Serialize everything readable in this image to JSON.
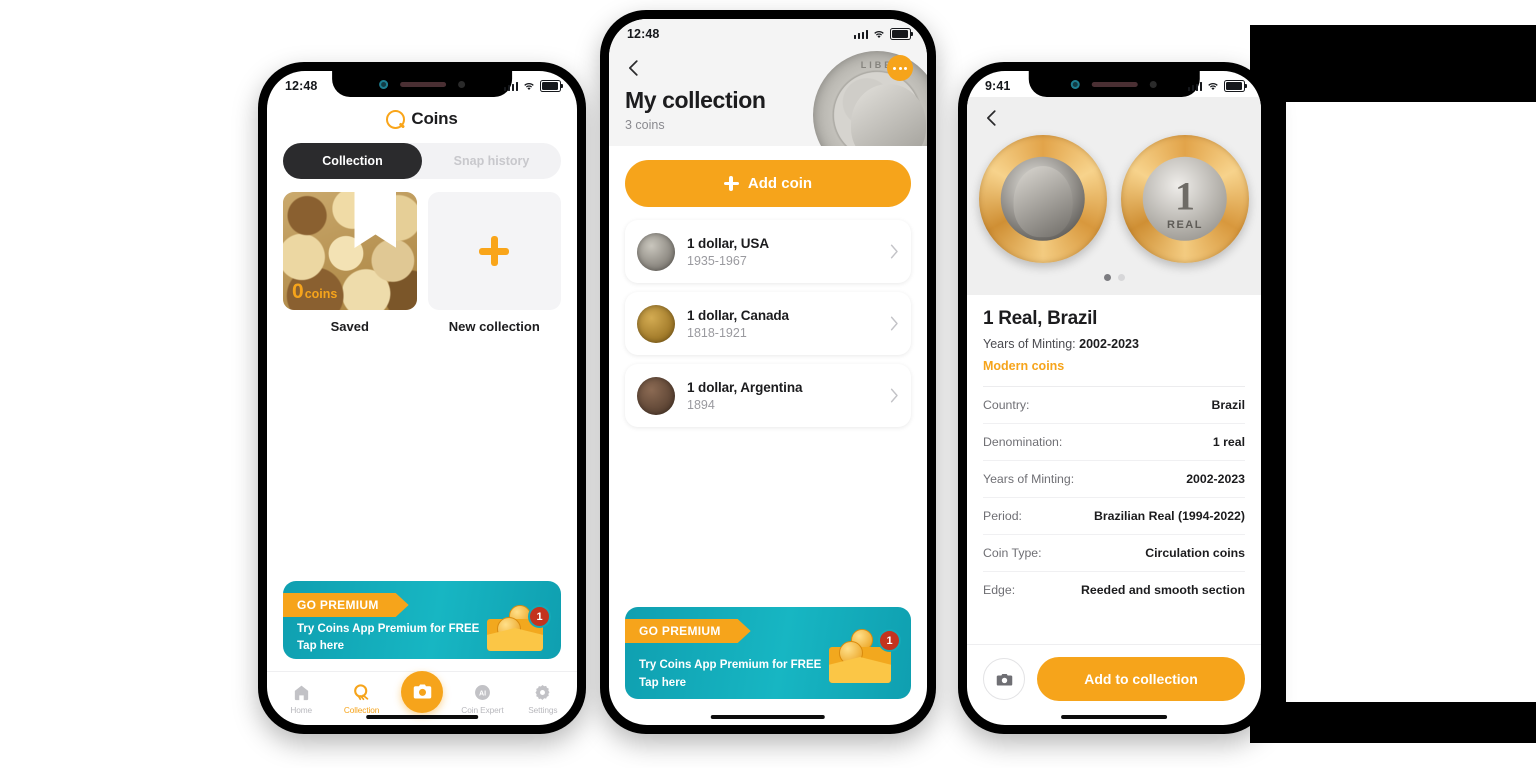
{
  "theme": {
    "accent": "#F6A41B",
    "dark": "#2b2b2d",
    "teal": "#17b6c3",
    "badge_red": "#C4331E"
  },
  "phone1": {
    "status": {
      "time": "12:48"
    },
    "app_title": "Coins",
    "tabs": [
      {
        "label": "Collection",
        "active": true
      },
      {
        "label": "Snap history",
        "active": false
      }
    ],
    "collections": [
      {
        "label": "Saved",
        "count": "0",
        "count_unit": "coins",
        "type": "thumbnail"
      },
      {
        "label": "New collection",
        "type": "add"
      }
    ],
    "promo": {
      "ribbon": "GO PREMIUM",
      "line1": "Try Coins App Premium for FREE",
      "line2": "Tap here",
      "badge": "1"
    },
    "nav": [
      {
        "label": "Home",
        "icon": "home-icon",
        "active": false
      },
      {
        "label": "Collection",
        "icon": "collection-icon",
        "active": true
      },
      {
        "label": "",
        "icon": "camera-icon",
        "active": false,
        "fab": true
      },
      {
        "label": "Coin Expert",
        "icon": "ai-icon",
        "active": false
      },
      {
        "label": "Settings",
        "icon": "gear-icon",
        "active": false
      }
    ]
  },
  "phone2": {
    "status": {
      "time": "12:48"
    },
    "title": "My collection",
    "subtitle": "3 coins",
    "add_button": "Add coin",
    "coins": [
      {
        "name": "1 dollar, USA",
        "years": "1935-1967"
      },
      {
        "name": "1 dollar, Canada",
        "years": "1818-1921"
      },
      {
        "name": "1 dollar, Argentina",
        "years": "1894"
      }
    ],
    "promo": {
      "ribbon": "GO PREMIUM",
      "line1": "Try Coins App Premium for FREE",
      "line2": "Tap here",
      "badge": "1"
    }
  },
  "phone3": {
    "status": {
      "time": "9:41"
    },
    "coin_name": "1 Real, Brazil",
    "years_label": "Years of Minting:",
    "years_value": "2002-2023",
    "category": "Modern coins",
    "gallery": {
      "pages": 2,
      "current": 1,
      "face_text": "1",
      "reverse_text": "REAL"
    },
    "specs": [
      {
        "key": "Country:",
        "value": "Brazil"
      },
      {
        "key": "Denomination:",
        "value": "1 real"
      },
      {
        "key": "Years of Minting:",
        "value": "2002-2023"
      },
      {
        "key": "Period:",
        "value": "Brazilian Real (1994-2022)"
      },
      {
        "key": "Coin Type:",
        "value": "Circulation coins"
      },
      {
        "key": "Edge:",
        "value": "Reeded and smooth section"
      }
    ],
    "add_to_collection": "Add to collection"
  }
}
